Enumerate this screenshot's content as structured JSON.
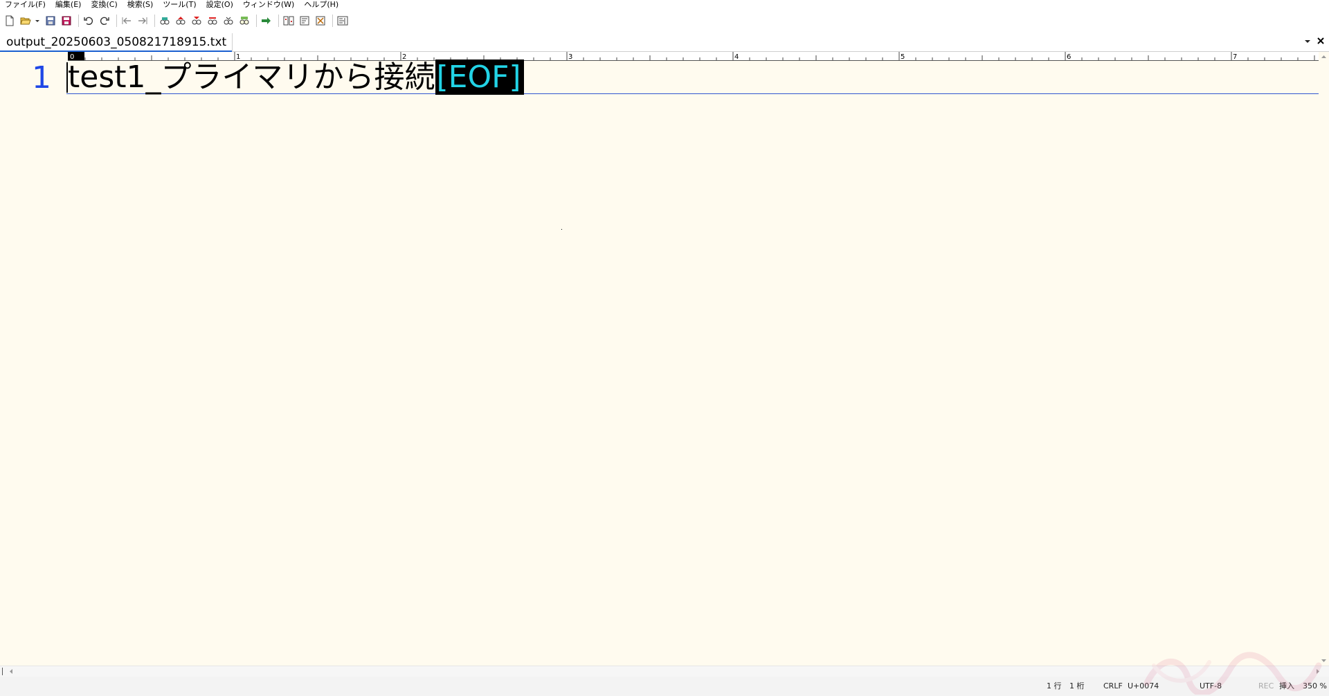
{
  "menubar": {
    "items": [
      "ファイル(F)",
      "編集(E)",
      "変換(C)",
      "検索(S)",
      "ツール(T)",
      "設定(O)",
      "ウィンドウ(W)",
      "ヘルプ(H)"
    ]
  },
  "toolbar": {
    "icons": [
      "new-file-icon",
      "open-file-icon",
      "save-icon",
      "save-all-icon",
      "undo-icon",
      "redo-icon",
      "jump-back-icon",
      "jump-forward-icon",
      "find-icon",
      "find-previous-icon",
      "find-next-icon",
      "replace-icon",
      "grep-icon",
      "grep-replace-icon",
      "tag-jump-icon",
      "compare-icon",
      "sort-icon",
      "convert-icon",
      "outline-icon"
    ]
  },
  "tab": {
    "filename": "output_20250603_050821718915.txt"
  },
  "ruler": {
    "marks": [
      "0",
      "1",
      "2",
      "3",
      "4",
      "5",
      "6",
      "7"
    ]
  },
  "editor": {
    "line_number": "1",
    "text": "test1_プライマリから接続",
    "eof_marker": "[EOF]",
    "colors": {
      "background": "#fffbef",
      "line_number": "#1f47e6",
      "eof_bg": "#000000",
      "eof_fg": "#22d3e6"
    }
  },
  "status": {
    "line": "1 行",
    "column": "1 桁",
    "line_ending": "CRLF",
    "codepoint": "U+0074",
    "encoding": "UTF-8",
    "rec": "REC",
    "insert_mode": "挿入",
    "zoom": "350 %"
  }
}
